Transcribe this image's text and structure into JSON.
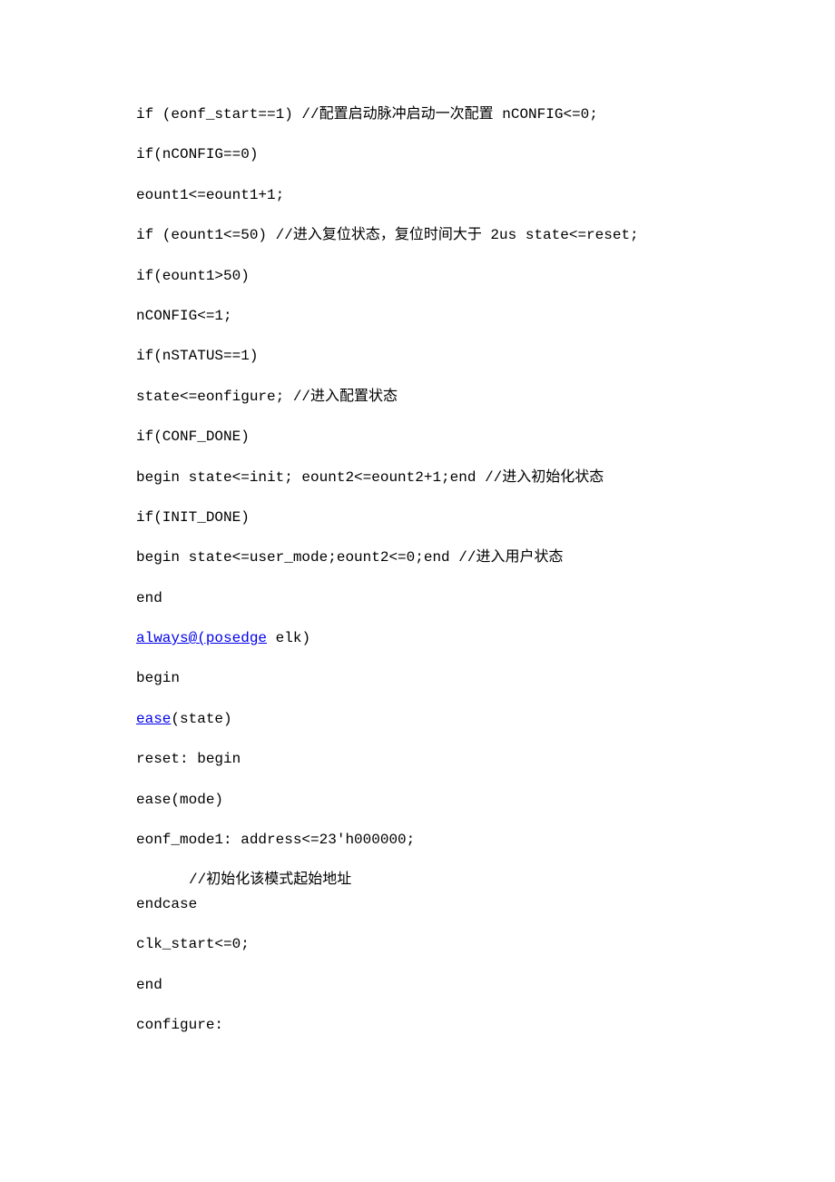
{
  "lines": {
    "l1": "if (eonf_start==1) //配置启动脉冲启动一次配置 nCONFIG<=0;",
    "l2": "if(nCONFIG==0)",
    "l3": "eount1<=eount1+1;",
    "l4": "if (eount1<=50) //进入复位状态，复位时间大于 2us state<=reset;",
    "l5": "if(eount1>50)",
    "l6": "nCONFIG<=1;",
    "l7": "if(nSTATUS==1)",
    "l8": "state<=eonfigure; //进入配置状态",
    "l9": "if(CONF_DONE)",
    "l10": "begin state<=init; eount2<=eount2+1;end //进入初始化状态",
    "l11": "if(INIT_DONE)",
    "l12": "begin state<=user_mode;eount2<=0;end //进入用户状态",
    "l13": "end",
    "l14a": "always@(posedge",
    "l14b": " elk)",
    "l15": "begin",
    "l16a": "ease",
    "l16b": "(state)",
    "l17": "reset: begin",
    "l18": "ease(mode)",
    "l19": "eonf_mode1: address<=23'h000000;",
    "l20": "//初始化该模式起始地址",
    "l21": "endcase",
    "l22": "clk_start<=0;",
    "l23": "end",
    "l24": "configure:"
  }
}
